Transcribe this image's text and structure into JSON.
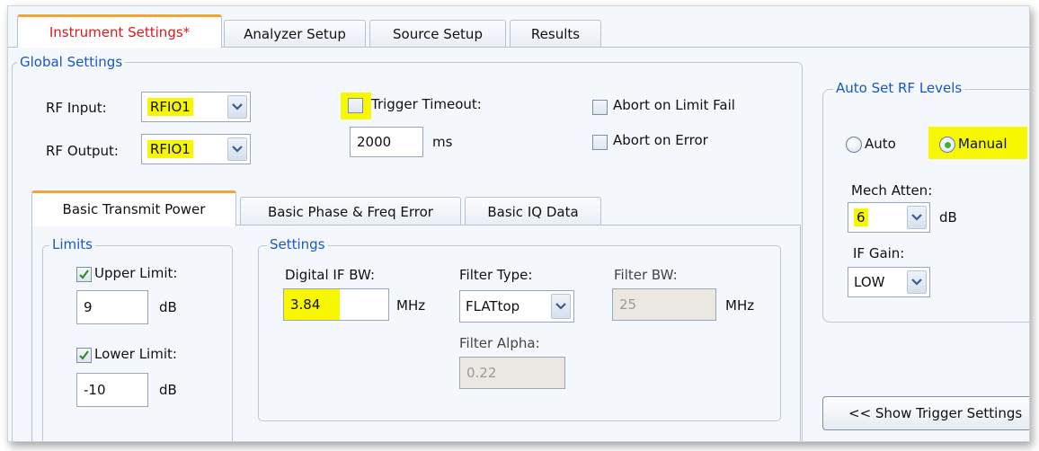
{
  "tabs": [
    {
      "label": "Instrument Settings*",
      "active": true
    },
    {
      "label": "Analyzer Setup",
      "active": false
    },
    {
      "label": "Source Setup",
      "active": false
    },
    {
      "label": "Results",
      "active": false
    }
  ],
  "global_settings": {
    "legend": "Global Settings",
    "rf_input_label": "RF Input:",
    "rf_input_value": "RFIO1",
    "rf_output_label": "RF Output:",
    "rf_output_value": "RFIO1",
    "trigger_timeout_label": "Trigger Timeout:",
    "trigger_timeout_checked": false,
    "trigger_timeout_value": "2000",
    "trigger_timeout_unit": "ms",
    "abort_limit_label": "Abort on Limit Fail",
    "abort_limit_checked": false,
    "abort_error_label": "Abort on Error",
    "abort_error_checked": false
  },
  "auto_rf": {
    "legend": "Auto Set RF Levels",
    "auto_label": "Auto",
    "manual_label": "Manual",
    "selected": "Manual",
    "mech_atten_label": "Mech Atten:",
    "mech_atten_value": "6",
    "mech_atten_unit": "dB",
    "if_gain_label": "IF Gain:",
    "if_gain_value": "LOW"
  },
  "sub_tabs": [
    {
      "label": "Basic Transmit Power",
      "active": true
    },
    {
      "label": "Basic Phase & Freq Error",
      "active": false
    },
    {
      "label": "Basic IQ Data",
      "active": false
    }
  ],
  "limits": {
    "legend": "Limits",
    "upper_label": "Upper Limit:",
    "upper_checked": true,
    "upper_value": "9",
    "upper_unit": "dB",
    "lower_label": "Lower Limit:",
    "lower_checked": true,
    "lower_value": "-10",
    "lower_unit": "dB"
  },
  "settings": {
    "legend": "Settings",
    "digital_if_bw_label": "Digital IF BW:",
    "digital_if_bw_value": "3.84",
    "digital_if_bw_unit": "MHz",
    "filter_type_label": "Filter Type:",
    "filter_type_value": "FLATtop",
    "filter_bw_label": "Filter BW:",
    "filter_bw_value": "25",
    "filter_bw_unit": "MHz",
    "filter_alpha_label": "Filter Alpha:",
    "filter_alpha_value": "0.22"
  },
  "show_trigger_button": "<< Show Trigger Settings",
  "icons": {
    "dropdown": "chevron-down-icon",
    "check": "checkmark-icon",
    "radio": "radio-dot-icon"
  },
  "colors": {
    "highlight": "#f7f700",
    "active_tab_text": "#e01818",
    "legend_text": "#1a56c8",
    "tab_accent": "#f0a53a"
  }
}
